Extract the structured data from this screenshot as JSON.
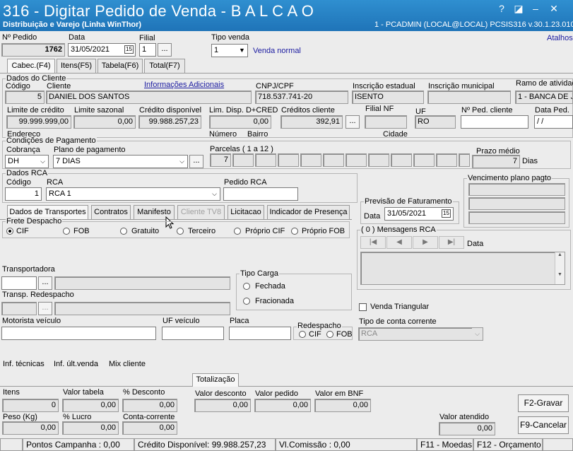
{
  "window": {
    "title": "316 - Digitar Pedido de Venda - B A L C A O",
    "subtitle": "Distribuição e Varejo (Linha WinThor)",
    "user_info": "1 - PCADMIN (LOCAL@LOCAL)   PCSIS316  v.30.1.23.010",
    "btn_help": "?",
    "btn_restore": "◪",
    "btn_min": "–",
    "btn_close": "✕"
  },
  "header": {
    "atalhos": "Atalhos",
    "pedido_label": "Nº Pedido",
    "pedido_value": "1762",
    "data_label": "Data",
    "data_value": "31/05/2021",
    "filial_label": "Filial",
    "filial_value": "1",
    "tipo_venda_label": "Tipo venda",
    "tipo_venda_value": "1",
    "tipo_venda_desc": "Venda normal"
  },
  "tabs": [
    "Cabec.(F4)",
    "Itens(F5)",
    "Tabela(F6)",
    "Total(F7)"
  ],
  "cliente": {
    "group_label": "Dados do Cliente",
    "codigo_label": "Código",
    "codigo_value": "5",
    "cliente_label": "Cliente",
    "cliente_value": "DANIEL DOS SANTOS",
    "info_link": "Informações Adicionais",
    "cnpj_label": "CNPJ/CPF",
    "cnpj_value": "718.537.741-20",
    "ie_label": "Inscrição estadual",
    "ie_value": "ISENTO",
    "im_label": "Inscrição municipal",
    "im_value": "",
    "ramo_label": "Ramo de atividade",
    "ramo_value": "1 - BANCA DE JORNAL",
    "limite_label": "Limite de crédito",
    "limite_value": "99.999.999,00",
    "sazonal_label": "Limite sazonal",
    "sazonal_value": "0,00",
    "credito_label": "Crédito disponível",
    "credito_value": "99.988.257,23",
    "limdisp_label": "Lim. Disp. D+CRED",
    "limdisp_value": "0,00",
    "creditos_label": "Créditos cliente",
    "creditos_value": "392,91",
    "filialnf_label": "Filial NF",
    "uf_label": "UF",
    "uf_value": "RO",
    "pedcli_label": "Nº Ped. cliente",
    "dataped_label": "Data Ped.",
    "dataped_value": " / /",
    "endereco_label": "Endereco",
    "numero_label": "Número",
    "bairro_label": "Bairro",
    "cidade_label": "Cidade"
  },
  "pagamento": {
    "group_label": "Condições de Pagamento",
    "cobranca_label": "Cobrança",
    "cobranca_value": "DH",
    "plano_label": "Plano de pagamento",
    "plano_value": "7 DIAS",
    "parcelas_label": "Parcelas ( 1 a 12 )",
    "parcela1": "7",
    "prazo_label": "Prazo médio",
    "prazo_value": "7",
    "prazo_unit": "Dias"
  },
  "rca": {
    "group_label": "Dados RCA",
    "codigo_label": "Código",
    "codigo_value": "1",
    "rca_label": "RCA",
    "rca_value": "RCA 1",
    "pedido_label": "Pedido RCA",
    "pedido_value": ""
  },
  "vencimento": {
    "group_label": "Vencimento plano pagto"
  },
  "previsao": {
    "group_label": "Previsão de Faturamento",
    "data_label": "Data",
    "data_value": "31/05/2021"
  },
  "subtabs": [
    "Dados de Transportes",
    "Contratos",
    "Manifesto",
    "Cliente TV8",
    "Licitacao",
    "Indicador de Presença"
  ],
  "frete": {
    "group_label": "Frete Despacho",
    "options": [
      "CIF",
      "FOB",
      "Gratuito",
      "Terceiro",
      "Próprio CIF",
      "Próprio FOB"
    ]
  },
  "mensagens": {
    "group_label": "( 0 ) Mensagens RCA",
    "data_label": "Data",
    "nav": [
      "|◀",
      "◀",
      "▶",
      "▶|"
    ]
  },
  "transporte": {
    "transportadora_label": "Transportadora",
    "redespacho_label": "Transp. Redespacho",
    "tipo_carga_label": "Tipo Carga",
    "carga_options": [
      "Fechada",
      "Fracionada"
    ],
    "venda_triangular": "Venda Triangular",
    "motorista_label": "Motorista veículo",
    "uf_veiculo_label": "UF veículo",
    "placa_label": "Placa",
    "redespacho_group": "Redespacho",
    "redespacho_options": [
      "CIF",
      "FOB"
    ],
    "conta_corrente_label": "Tipo de conta corrente",
    "conta_corrente_value": "RCA"
  },
  "links": [
    "Inf. técnicas",
    "Inf. últ.venda",
    "Mix cliente"
  ],
  "totalizacao": {
    "tab_label": "Totalização",
    "itens_label": "Itens",
    "itens_value": "0",
    "valor_tabela_label": "Valor tabela",
    "valor_tabela_value": "0,00",
    "desconto_label": "% Desconto",
    "desconto_value": "0,00",
    "valor_desconto_label": "Valor desconto",
    "valor_desconto_value": "0,00",
    "valor_pedido_label": "Valor pedido",
    "valor_pedido_value": "0,00",
    "valor_bnf_label": "Valor em BNF",
    "valor_bnf_value": "0,00",
    "peso_label": "Peso (Kg)",
    "peso_value": "0,00",
    "lucro_label": "% Lucro",
    "lucro_value": "0,00",
    "conta_corrente_label": "Conta-corrente",
    "conta_corrente_value": "0,00",
    "valor_atendido_label": "Valor atendido",
    "valor_atendido_value": "0,00",
    "f2_label": "F2-Gravar",
    "f9_label": "F9-Cancelar"
  },
  "statusbar": {
    "pontos": "Pontos Campanha : 0,00",
    "credito": "Crédito Disponível: 99.988.257,23",
    "comissao": "Vl.Comissão : 0,00",
    "f11": "F11 - Moedas",
    "f12": "F12 - Orçamento"
  }
}
